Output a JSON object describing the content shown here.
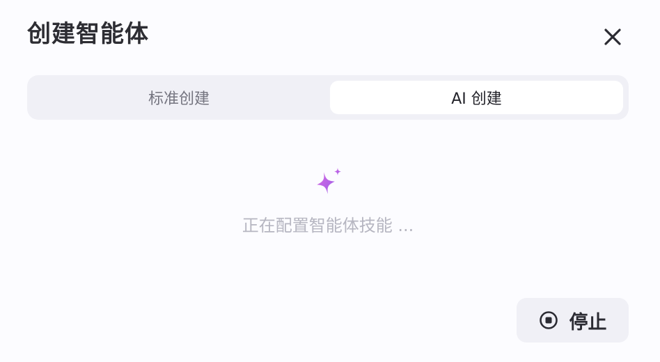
{
  "dialog": {
    "title": "创建智能体",
    "close_icon": "close-icon"
  },
  "tabs": {
    "standard_label": "标准创建",
    "ai_label": "AI 创建",
    "active": "ai"
  },
  "content": {
    "sparkle_icon": "sparkle-icon",
    "status_text": "正在配置智能体技能 ..."
  },
  "stop": {
    "label": "停止",
    "icon": "stop-circle-icon"
  },
  "colors": {
    "sparkle_start": "#d66be3",
    "sparkle_end": "#9d5ce8",
    "muted_text": "#b6b6c1",
    "segment_bg": "#f0f0f6"
  }
}
